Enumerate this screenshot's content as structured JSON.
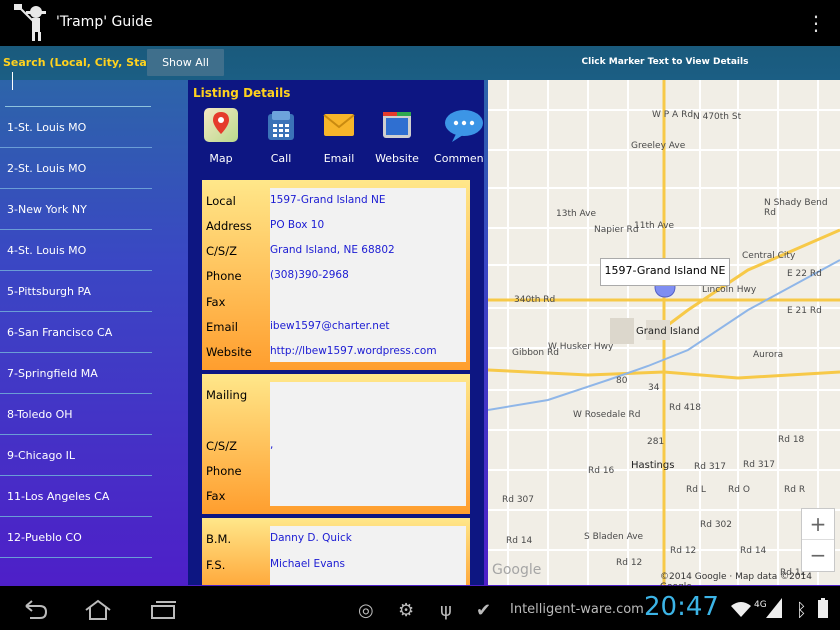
{
  "app": {
    "title": "'Tramp' Guide"
  },
  "top": {
    "search_label": "Search (Local, City, State)",
    "show_all": "Show All",
    "marker_hint": "Click Marker Text to View Details",
    "search_value": ""
  },
  "list": [
    "1-St. Louis MO",
    "2-St. Louis MO",
    "3-New York NY",
    "4-St. Louis MO",
    "5-Pittsburgh PA",
    "6-San Francisco CA",
    "7-Springfield MA",
    "8-Toledo OH",
    "9-Chicago IL",
    "11-Los Angeles CA",
    "12-Pueblo CO"
  ],
  "details": {
    "title": "Listing Details",
    "actions": [
      {
        "label": "Map",
        "icon": "map-icon"
      },
      {
        "label": "Call",
        "icon": "phone-icon"
      },
      {
        "label": "Email",
        "icon": "email-icon"
      },
      {
        "label": "Website",
        "icon": "website-icon"
      },
      {
        "label": "Comment",
        "icon": "comment-icon"
      }
    ],
    "contact": [
      {
        "k": "Local",
        "v": "1597-Grand Island NE"
      },
      {
        "k": "Address",
        "v": "PO Box 10"
      },
      {
        "k": "C/S/Z",
        "v": "Grand Island, NE 68802"
      },
      {
        "k": "Phone",
        "v": "(308)390-2968"
      },
      {
        "k": "Fax",
        "v": ""
      },
      {
        "k": "Email",
        "v": "ibew1597@charter.net"
      },
      {
        "k": "Website",
        "v": "http://lbew1597.wordpress.com"
      }
    ],
    "mailing": [
      {
        "k": "Mailing",
        "v": ""
      },
      {
        "k": "C/S/Z",
        "v": ","
      },
      {
        "k": "Phone",
        "v": ""
      },
      {
        "k": "Fax",
        "v": ""
      }
    ],
    "officers": [
      {
        "k": "B.M.",
        "v": "Danny D. Quick"
      },
      {
        "k": "F.S.",
        "v": "Michael Evans"
      }
    ]
  },
  "map": {
    "callout": "1597-Grand Island NE",
    "labels": [
      "W P A Rd",
      "N 470th St",
      "Greeley Ave",
      "13th Ave",
      "Napier Rd",
      "11th Ave",
      "N Shady Bend Rd",
      "Central City",
      "E 22 Rd",
      "340th Rd",
      "Lincoln Hwy",
      "E 21 Rd",
      "Grand Island",
      "W Husker Hwy",
      "Aurora",
      "Gibbon Rd",
      "80",
      "34",
      "W Rosedale Rd",
      "Rd 418",
      "281",
      "Rd 18",
      "Hastings",
      "Rd 317",
      "Rd 317",
      "Rd 16",
      "Rd L",
      "Rd O",
      "Rd R",
      "Rd 307",
      "Rd 302",
      "S Bladen Ave",
      "Rd 14",
      "Rd 12",
      "Rd 14",
      "Rd 12",
      "Rd 12"
    ],
    "attribution": "©2014 Google · Map data ©2014 Google",
    "google": "Google",
    "zoom_in": "+",
    "zoom_out": "−"
  },
  "status": {
    "brand": "Intelligent-ware.com",
    "time": "20:47",
    "network": "4G"
  }
}
